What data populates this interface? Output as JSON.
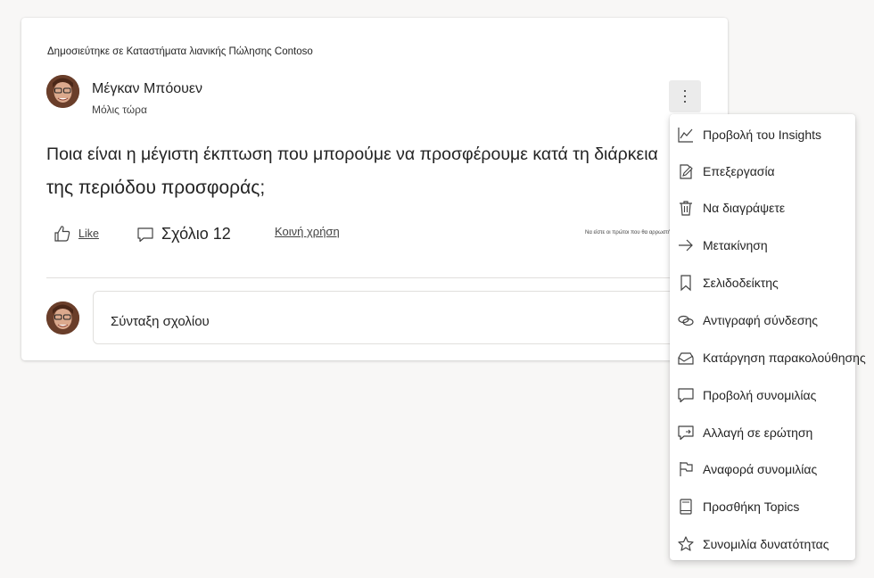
{
  "post": {
    "posted_in": "Δημοσιεύτηκε σε Καταστήματα λιανικής Πώλησης Contoso",
    "author": "Μέγκαν Μπόουεν",
    "timestamp": "Μόλις τώρα",
    "question_line1": "Ποια είναι η μέγιστη έκπτωση που μπορούμε να προσφέρουμε κατά τη διάρκεια",
    "question_line2": "της περιόδου προσφοράς;",
    "more_symbol": "⋯"
  },
  "actions": {
    "like": "Like",
    "comment": "Σχόλιο 12",
    "share": "Κοινή χρήση",
    "first_to_react": "Να είστε οι πρώτοι που θα αρρωστήσετε"
  },
  "composer": {
    "placeholder": "Σύνταξη σχολίου"
  },
  "menu": {
    "items": [
      {
        "label": "Προβολή του Insights",
        "icon": "chart-icon"
      },
      {
        "label": "Επεξεργασία",
        "icon": "edit-icon"
      },
      {
        "label": "Να διαγράψετε",
        "icon": "trash-icon"
      },
      {
        "label": "Μετακίνηση",
        "icon": "arrow-right-icon"
      },
      {
        "label": "Σελιδοδείκτης",
        "icon": "bookmark-icon"
      },
      {
        "label": "Αντιγραφή σύνδεσης",
        "icon": "link-icon"
      },
      {
        "label": "Κατάργηση παρακολούθησης",
        "icon": "tray-icon"
      },
      {
        "label": "Προβολή συνομιλίας",
        "icon": "chat-icon"
      },
      {
        "label": "Αλλαγή σε ερώτηση",
        "icon": "chat-swap-icon"
      },
      {
        "label": "Αναφορά συνομιλίας",
        "icon": "flag-icon"
      },
      {
        "label": "Προσθήκη Topics",
        "icon": "book-icon"
      },
      {
        "label": "Συνομιλία δυνατότητας",
        "icon": "star-icon"
      }
    ]
  },
  "colors": {
    "page_bg": "#f8f7f6",
    "card_bg": "#ffffff",
    "text": "#242424",
    "border": "#e1dfdd"
  }
}
